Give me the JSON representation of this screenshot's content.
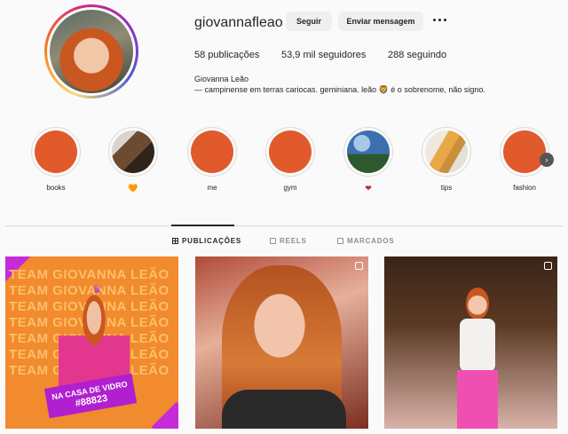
{
  "profile": {
    "username": "giovannafleao",
    "follow_label": "Seguir",
    "message_label": "Enviar mensagem",
    "stats": {
      "posts": "58 publicações",
      "followers": "53,9 mil seguidores",
      "following": "288 seguindo"
    },
    "full_name": "Giovanna Leão",
    "bio": "— campinense em terras cariocas. geminiana. leão 🦁 é o sobrenome, não signo."
  },
  "highlights": [
    {
      "label": "books",
      "image": "orange"
    },
    {
      "label": "🧡",
      "image": "dog"
    },
    {
      "label": "me",
      "image": "orange"
    },
    {
      "label": "gym",
      "image": "orange"
    },
    {
      "label": "❤",
      "image": "sky"
    },
    {
      "label": "tips",
      "image": "tips"
    },
    {
      "label": "fashion",
      "image": "orange"
    }
  ],
  "tabs": {
    "posts": "PUBLICAÇÕES",
    "reels": "REELS",
    "tagged": "MARCADOS"
  },
  "posts": {
    "first": {
      "team_lines": [
        "TEAM GIOVANNA LEÃO",
        "TEAM GIOVANNA LEÃO",
        "TEAM GIOVANNA LEÃO",
        "TEAM GIOVANNA LEÃO",
        "TEAM GIOVANNA LEÃO",
        "TEAM GIOVANNA LEÃO",
        "TEAM GIOVANNA LEÃO"
      ],
      "banner_line1": "NA CASA DE VIDRO",
      "banner_line2": "#88823"
    }
  },
  "colors": {
    "highlight_fill": "#e05a2b",
    "post1_bg": "#f28a2e",
    "banner_bg": "#b020d0",
    "text": "#262626",
    "button_bg": "#efefef"
  }
}
